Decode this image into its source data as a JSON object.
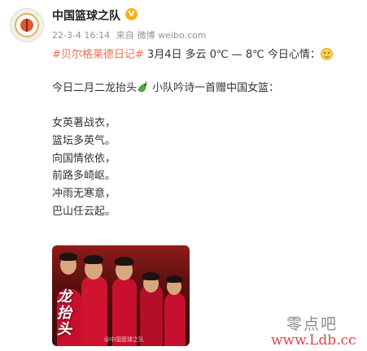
{
  "post": {
    "username": "中国篮球之队",
    "vip_badge": "V",
    "date": "22-3-4 16:14",
    "source_prefix": "来自",
    "source": "微博 weibo.com",
    "hashtag": "#贝尔格莱德日记#",
    "line1_text": " 3月4日 多云 0℃ — 8℃ 今日心情：",
    "line2_text_a": "今日二月二龙抬头",
    "line2_text_b": " 小队吟诗一首赠中国女篮：",
    "poem": [
      "女英著战衣，",
      "篮坛多英气。",
      "向国情依依，",
      "前路多崎岖。",
      "冲雨无寒意，",
      "巴山任云起。"
    ],
    "image_text": "龙抬头",
    "image_watermark": "@中国篮球之队"
  },
  "watermark": {
    "name": "零点吧",
    "url": "www.Ldb.cc"
  },
  "icons": {
    "avatar": "basketball-team-logo",
    "mood": "smile-emoji",
    "dragon": "dragon-emoji"
  },
  "colors": {
    "hashtag": "#eb7350",
    "meta": "#939393",
    "watermark_url": "#e64444"
  }
}
